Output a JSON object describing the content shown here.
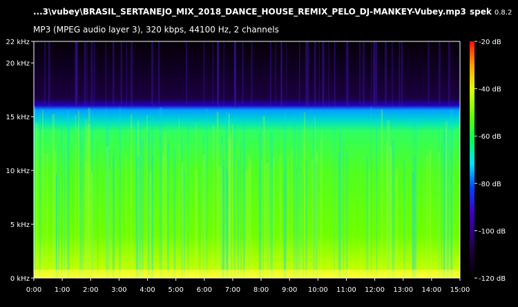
{
  "window": {
    "file_title": "...3\\vubey\\BRASIL_SERTANEJO_MIX_2018_DANCE_HOUSE_REMIX_PELO_DJ-MANKEY-Vubey.mp3",
    "app_name": "spek",
    "app_version": "0.8.2",
    "file_info": "MP3 (MPEG audio layer 3), 320 kbps, 44100 Hz, 2 channels"
  },
  "chart_data": {
    "type": "heatmap",
    "x_tick_labels": [
      "0:00",
      "1:00",
      "2:00",
      "3:00",
      "4:00",
      "5:00",
      "6:00",
      "7:00",
      "8:00",
      "9:00",
      "10:00",
      "11:00",
      "12:00",
      "13:00",
      "14:00",
      "15:00"
    ],
    "y_tick_labels": [
      "0 kHz",
      "5 kHz",
      "10 kHz",
      "15 kHz",
      "20 kHz",
      "22 kHz"
    ],
    "y_ticks_khz": [
      0,
      5,
      10,
      15,
      20,
      22
    ],
    "x_range_minutes": [
      0,
      15
    ],
    "y_range_khz": [
      0,
      22
    ],
    "colorbar_labels": [
      "-20 dB",
      "-40 dB",
      "-60 dB",
      "-80 dB",
      "-100 dB",
      "-120 dB"
    ],
    "colorbar_range_db": [
      -120,
      -20
    ],
    "lowpass_cutoff_khz": 16,
    "colors": {
      "scale": [
        "#000000",
        "#1a0030",
        "#3a00a0",
        "#0000ff",
        "#00c8ff",
        "#00ff80",
        "#40ff00",
        "#b0ff00",
        "#ffff00",
        "#ffa000",
        "#ff2000"
      ],
      "axis": "#ffffff",
      "background": "#000000"
    }
  }
}
